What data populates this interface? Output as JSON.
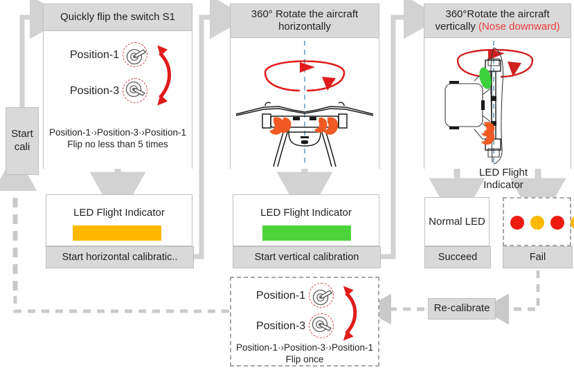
{
  "flow": {
    "start": {
      "label": "Start\ncali"
    },
    "step1": {
      "header": "Quickly flip the switch S1",
      "position_a": "Position-1",
      "position_b": "Position-3",
      "switch_icon_a": "toggle-switch-up-icon",
      "switch_icon_b": "toggle-switch-down-icon",
      "flip_arrow_icon": "double-headed-curved-arrow-icon",
      "caption_line1": "Position-1·›Position-3·›Position-1",
      "caption_line2": "Flip no less than 5 times"
    },
    "step2": {
      "header_line1": "360° Rotate the aircraft",
      "header_line2": "horizontally",
      "illustration": "drone-front-view-icon",
      "rotation_icon": "horizontal-rotation-arrow-icon",
      "axis_icon": "vertical-dashed-axis-icon"
    },
    "step3": {
      "header_line1": "360°Rotate the aircraft",
      "header_line2_prefix": "vertically ",
      "header_line2_accent": "(Nose downward)",
      "illustration": "drone-side-view-icon",
      "rotation_icon": "vertical-rotation-arrow-icon",
      "axis_icon": "vertical-dashed-axis-icon"
    },
    "led_horizontal": {
      "title": "LED Flight Indicator",
      "bar_color": "#fcb900",
      "footer": "Start horizontal calibratic.."
    },
    "led_vertical": {
      "title": "LED Flight Indicator",
      "bar_color": "#4ed43b",
      "footer": "Start vertical calibration"
    },
    "led_result_label_line1": "LED Flight",
    "led_result_label_line2": "Indicator",
    "succeed": {
      "body": "Normal LED",
      "footer": "Succeed"
    },
    "fail": {
      "footer": "Fail",
      "dots": [
        "#ee1b11",
        "#fcb900",
        "#ee1b11",
        "#fcb900"
      ]
    },
    "recalibrate": {
      "label": "Re-calibrate"
    },
    "reflip": {
      "position_a": "Position-1",
      "position_b": "Position-3",
      "switch_icon_a": "toggle-switch-up-icon",
      "switch_icon_b": "toggle-switch-down-icon",
      "flip_arrow_icon": "double-headed-curved-arrow-icon",
      "caption_line1": "Position-1·›Position-3·›Position-1",
      "caption_line2": "Flip once"
    }
  },
  "colors": {
    "box_fill": "#d9d9d9",
    "box_border": "#bfbfbf",
    "connector": "#d2d2d2",
    "dashed_connector": "#c9c9c9",
    "accent_red": "#ef3b3b",
    "led_amber": "#fcb900",
    "led_green": "#4ed43b",
    "led_red": "#ee1b11",
    "drone_orange": "#f05a22",
    "drone_green": "#3bd23b"
  }
}
